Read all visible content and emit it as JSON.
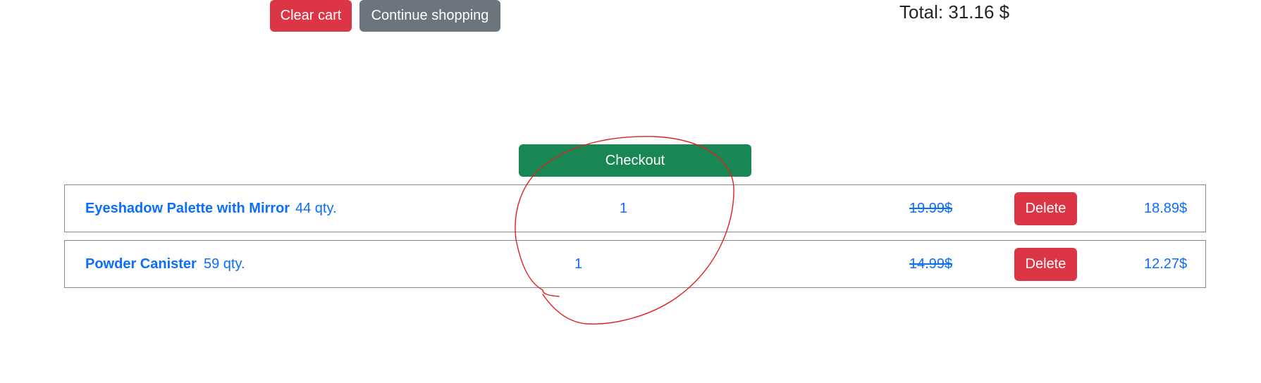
{
  "toolbar": {
    "clear_cart_label": "Clear cart",
    "continue_shopping_label": "Continue shopping"
  },
  "total": {
    "text": "Total: 31.16 $"
  },
  "checkout": {
    "label": "Checkout"
  },
  "cart": {
    "items": [
      {
        "name": "Eyeshadow Palette with Mirror",
        "stock": "44 qty.",
        "quantity": "1",
        "old_price": "19.99$",
        "delete_label": "Delete",
        "price": "18.89$"
      },
      {
        "name": "Powder Canister",
        "stock": "59 qty.",
        "quantity": "1",
        "old_price": "14.99$",
        "delete_label": "Delete",
        "price": "12.27$"
      }
    ]
  },
  "colors": {
    "danger": "#dc3545",
    "secondary": "#6c757d",
    "success": "#198754",
    "link": "#0d6efd",
    "annotation": "#e02020"
  }
}
